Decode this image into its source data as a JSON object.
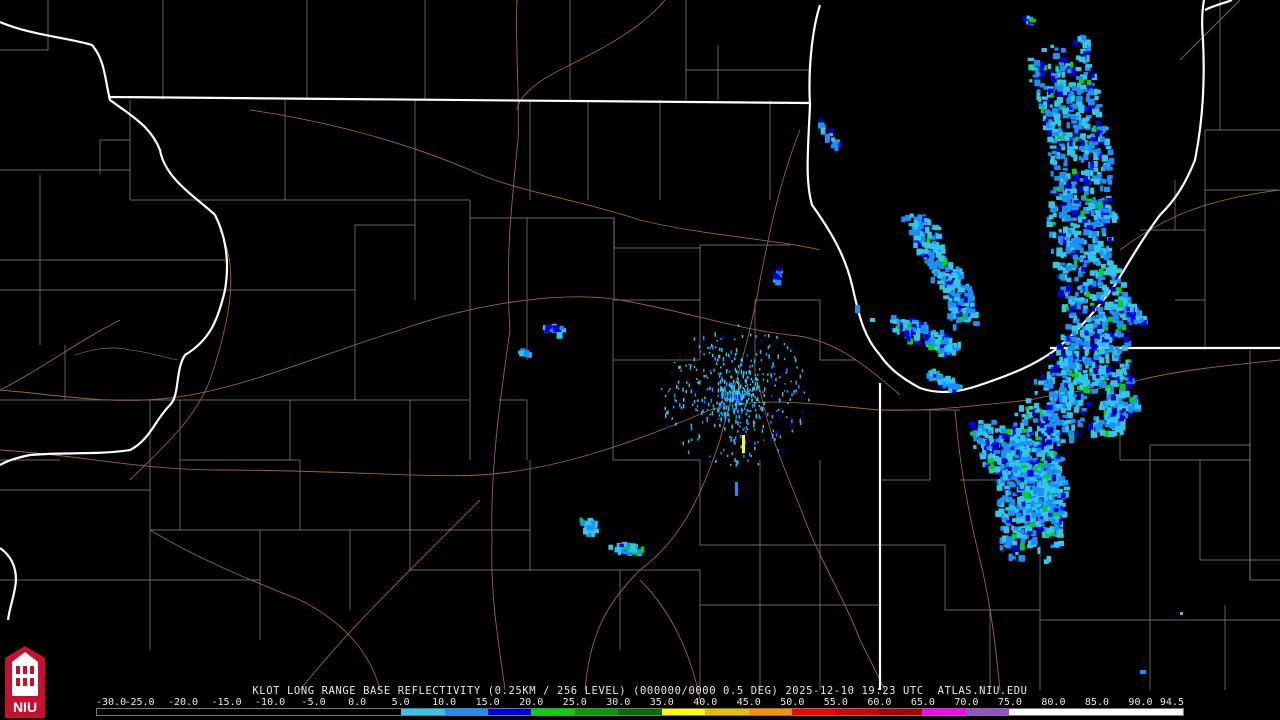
{
  "product_title": "KLOT LONG RANGE BASE REFLECTIVITY (0.25KM / 256 LEVEL) (000000/0000 0.5 DEG) 2025-12-10 19:23 UTC  ATLAS.NIU.EDU",
  "radar_site": "KLOT",
  "timestamp": "2025-12-10 19:23 UTC",
  "logo_text": "NIU",
  "colors": {
    "background": "#000000",
    "state_border": "#ffffff",
    "county_line": "#8a8a8a",
    "highway": "#a0623a"
  },
  "color_scale": {
    "labels": [
      "-30.0",
      "-25.0",
      "-20.0",
      "-15.0",
      "-10.0",
      "-5.0",
      "0.0",
      "5.0",
      "10.0",
      "15.0",
      "20.0",
      "25.0",
      "30.0",
      "35.0",
      "40.0",
      "45.0",
      "50.0",
      "55.0",
      "60.0",
      "65.0",
      "70.0",
      "75.0",
      "80.0",
      "85.0",
      "90.0",
      "94.5"
    ],
    "colors": [
      "#000000",
      "#000000",
      "#000000",
      "#000000",
      "#000000",
      "#000000",
      "#000000",
      "#30c8e8",
      "#1a90ff",
      "#0000e8",
      "#00d800",
      "#00a000",
      "#007000",
      "#ffff00",
      "#e8c000",
      "#ff9000",
      "#ff0000",
      "#d80000",
      "#b00000",
      "#ff00ff",
      "#9850c8",
      "#ffffff",
      "#ffffff",
      "#ffffff",
      "#ffffff"
    ]
  }
}
